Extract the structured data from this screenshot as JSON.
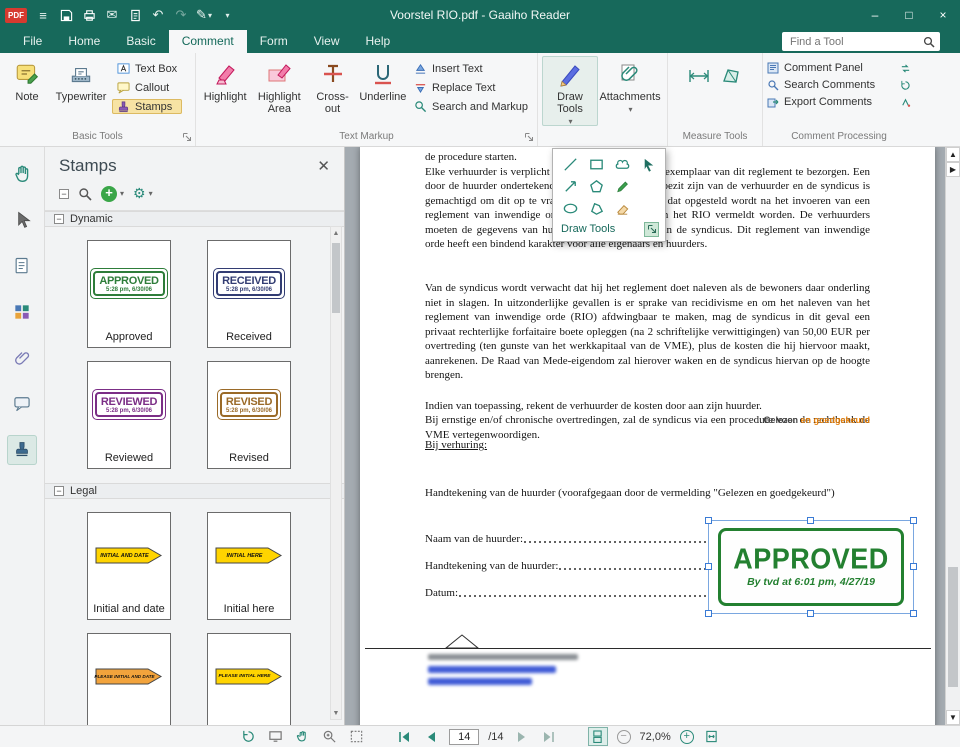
{
  "colors": {
    "titlebar_teal": "#17695b",
    "accent_teal": "#2a8a79",
    "stamps_button_highlight": "#f7e3a4",
    "doc_background": "#a4abb1",
    "selection_blue": "#3a7bd5",
    "approved_green": "#238030",
    "received_navy": "#333d73",
    "reviewed_purple": "#7b2e86",
    "revised_brown": "#8a6a33",
    "legal_yellow": "#ffd400",
    "legal_orange": "#f2a33c",
    "orange_text": "#e8810a"
  },
  "titlebar": {
    "pdf_badge": "PDF",
    "title": "Voorstel RIO.pdf - Gaaiho Reader"
  },
  "tabs": {
    "items": [
      "File",
      "Home",
      "Basic",
      "Comment",
      "Form",
      "View",
      "Help"
    ],
    "active": "Comment"
  },
  "find_tool": {
    "placeholder": "Find a Tool"
  },
  "ribbon": {
    "basic_tools_label": "Basic Tools",
    "note": "Note",
    "typewriter": "Typewriter",
    "text_box": "Text Box",
    "callout": "Callout",
    "stamps": "Stamps",
    "text_markup_label": "Text Markup",
    "highlight": "Highlight",
    "highlight_area": "Highlight Area",
    "cross_out": "Cross-out",
    "underline": "Underline",
    "insert_text": "Insert Text",
    "replace_text": "Replace Text",
    "search_and_markup": "Search and Markup",
    "draw_tools": "Draw Tools",
    "attachments": "Attachments",
    "measure_tools_label": "Measure Tools",
    "comment_panel": "Comment Panel",
    "search_comments": "Search Comments",
    "export_comments": "Export Comments",
    "comment_processing_label": "Comment Processing"
  },
  "draw_popup": {
    "label": "Draw Tools"
  },
  "stamps_panel": {
    "title": "Stamps",
    "dynamic_header": "Dynamic",
    "legal_header": "Legal",
    "dynamic": [
      {
        "title": "APPROVED",
        "subtitle": "5:28 pm, 6/30/06",
        "caption": "Approved"
      },
      {
        "title": "RECEIVED",
        "subtitle": "5:28 pm, 6/30/06",
        "caption": "Received"
      },
      {
        "title": "REVIEWED",
        "subtitle": "5:28 pm, 6/30/06",
        "caption": "Reviewed"
      },
      {
        "title": "REVISED",
        "subtitle": "5:28 pm, 6/30/06",
        "caption": "Revised"
      }
    ],
    "legal": [
      {
        "title": "INITIAL AND DATE",
        "caption": "Initial and date"
      },
      {
        "title": "INITIAL HERE",
        "caption": "Initial here"
      },
      {
        "title": "PLEASE INITIAL AND DATE",
        "caption": ""
      },
      {
        "title": "PLEASE INITIAL HERE",
        "caption": ""
      }
    ]
  },
  "document": {
    "frag_line": "de procedure starten.",
    "para_intro": "Elke verhuurder is verplicht om aan zijn huurder een exemplaar van dit reglement te bezorgen. Een door de huurder ondertekend exemplaar moet in het bezit zijn van de verhuurder en de syndicus is gemachtigd om dit op te vragen. In elk huurcontract dat opgesteld wordt na het invoeren van een reglement van inwendige orde moet het bestaan van het RIO vermeldt worden. De verhuurders moeten de gegevens van hun huurders doorgeven aan de syndicus. Dit reglement van inwendige orde heeft een bindend karakter voor alle eigenaars en huurders.",
    "para_main": "Van de syndicus wordt verwacht dat hij het reglement doet naleven als de bewoners daar onderling niet in slagen. In uitzonderlijke gevallen is er sprake van recidivisme en om het naleven van het reglement van inwendige orde (RIO) afdwingbaar te maken, mag de syndicus in dit geval een privaat rechterlijke forfaitaire boete opleggen (na 2 schriftelijke verwittigingen) van 50,00 EUR per overtreding (ten gunste van het werkkapitaal van de VME), plus de kosten die hij hiervoor maakt, aanrekenen. De Raad van Mede-eigendom zal hierover waken en de syndicus hiervan op de hoogte brengen.",
    "para_indien": "Indien van toepassing, rekent de verhuurder de kosten door aan zijn huurder.",
    "para_ernstige": "Bij ernstige en/of chronische overtredingen, zal de syndicus via een procedure voor de rechtbank de VME vertegenwoordigen.",
    "gelezen_prefix": "Gelezen",
    "gelezen_suffix": " en goedgekeurd",
    "bij_verhuring": "Bij verhuring:",
    "handtekening_intro": "Handtekening van de huurder (voorafgegaan door de vermelding \"Gelezen en goedgekeurd\")",
    "naam_line": "Naam van de huurder: ",
    "handtekening_line": "Handtekening van de huurder: ",
    "datum_line": "Datum: ",
    "stamp_title": "APPROVED",
    "stamp_byline": "By tvd at 6:01 pm, 4/27/19"
  },
  "statusbar": {
    "page_value": "14",
    "page_total": "/14",
    "zoom": "72,0%"
  }
}
